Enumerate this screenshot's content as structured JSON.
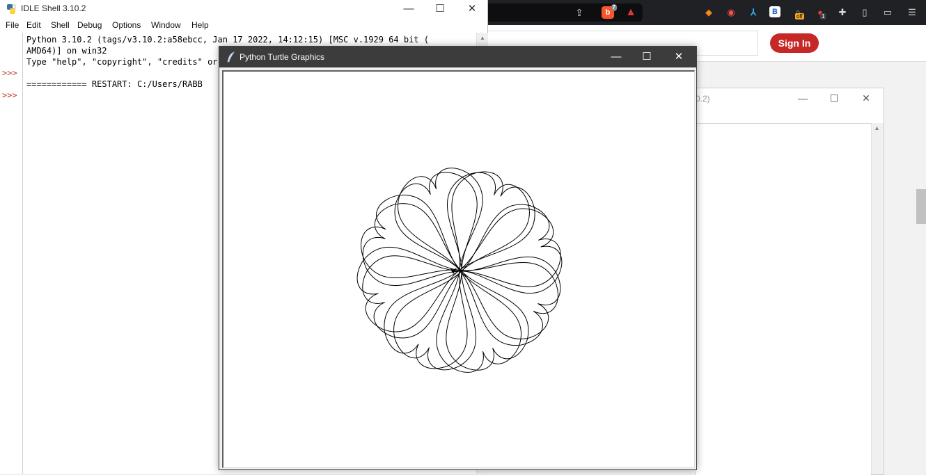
{
  "browser": {
    "signin_label": "Sign In",
    "brave_shield_count": "7",
    "extensions": [
      "metamask-icon",
      "recorder-icon",
      "a-plus-icon",
      "bitwarden-icon",
      "off-extension-icon",
      "red-extension-icon",
      "puzzle-icon",
      "sidebar-icon",
      "wallet-icon",
      "menu-icon"
    ],
    "bitwarden_glyph": "B",
    "off_badge": "off",
    "red_badge": "1",
    "colors": {
      "signin": "#c62828",
      "toolbar": "#202124"
    }
  },
  "bg_window": {
    "title_fragment": "0.2)"
  },
  "idle": {
    "title": "IDLE Shell 3.10.2",
    "menu": [
      "File",
      "Edit",
      "Shell",
      "Debug",
      "Options",
      "Window",
      "Help"
    ],
    "prompts": [
      ">>>",
      ">>>"
    ],
    "lines": [
      "Python 3.10.2 (tags/v3.10.2:a58ebcc, Jan 17 2022, 14:12:15) [MSC v.1929 64 bit (",
      "AMD64)] on win32",
      "Type \"help\", \"copyright\", \"credits\" or \"license()\" for more information.",
      "",
      "============ RESTART: C:/Users/RABB"
    ]
  },
  "turtle": {
    "title": "Python Turtle Graphics",
    "drawing": "flower-of-heart-petals",
    "petal_count": 8
  }
}
